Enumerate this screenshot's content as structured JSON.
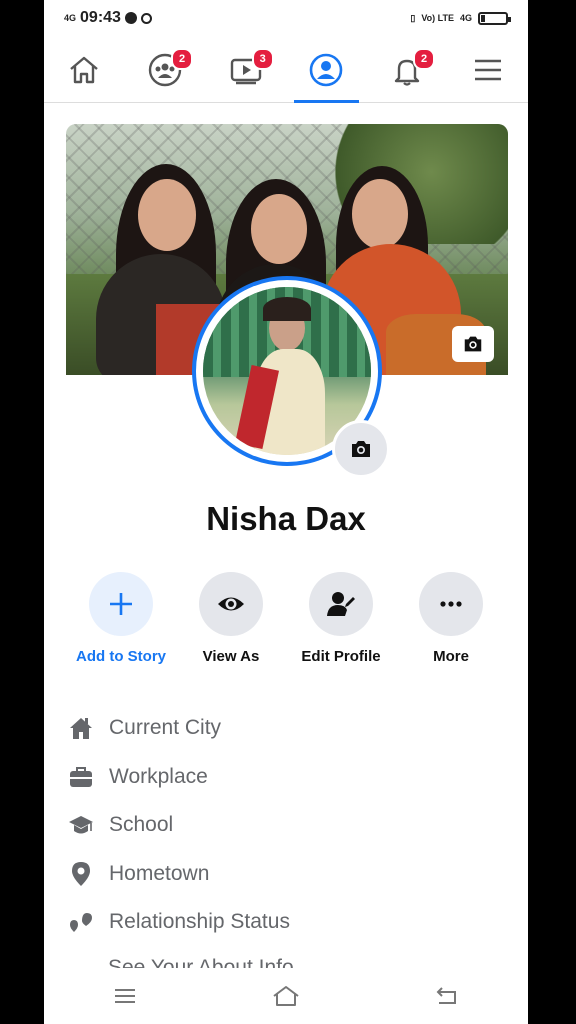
{
  "status_bar": {
    "signal_left": "4G",
    "time": "09:43",
    "network_right": "Vo) LTE",
    "network_4g": "4G",
    "battery_level": 0.15
  },
  "nav": {
    "tabs": [
      {
        "name": "home",
        "badge": ""
      },
      {
        "name": "groups",
        "badge": "2"
      },
      {
        "name": "watch",
        "badge": "3"
      },
      {
        "name": "profile",
        "badge": "",
        "active": true
      },
      {
        "name": "notifications",
        "badge": "2"
      },
      {
        "name": "menu",
        "badge": ""
      }
    ]
  },
  "profile": {
    "name": "Nisha Dax"
  },
  "actions": [
    {
      "label": "Add to Story",
      "icon": "plus-icon"
    },
    {
      "label": "View As",
      "icon": "eye-icon"
    },
    {
      "label": "Edit Profile",
      "icon": "edit-profile-icon"
    },
    {
      "label": "More",
      "icon": "more-dots-icon"
    }
  ],
  "info_items": [
    {
      "label": "Current City",
      "icon": "home-icon"
    },
    {
      "label": "Workplace",
      "icon": "briefcase-icon"
    },
    {
      "label": "School",
      "icon": "graduation-cap-icon"
    },
    {
      "label": "Hometown",
      "icon": "location-pin-icon"
    },
    {
      "label": "Relationship Status",
      "icon": "hearts-icon"
    }
  ],
  "partial_item": "See Your About Info",
  "colors": {
    "accent": "#1877f2",
    "badge": "#e41e3f",
    "muted_text": "#65676b",
    "action_bg": "#e4e6eb"
  }
}
